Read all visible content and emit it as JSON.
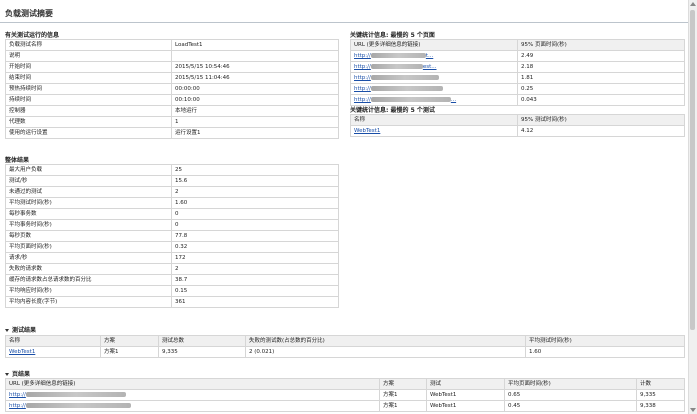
{
  "page_title": "负载测试摘要",
  "run_info": {
    "title": "有关测试运行的信息",
    "rows": [
      {
        "k": "负载测试名称",
        "v": "LoadTest1"
      },
      {
        "k": "说明",
        "v": ""
      },
      {
        "k": "开始时间",
        "v": "2015/5/15 10:54:46"
      },
      {
        "k": "结束时间",
        "v": "2015/5/15 11:04:46"
      },
      {
        "k": "预热持续时间",
        "v": "00:00:00"
      },
      {
        "k": "持续时间",
        "v": "00:10:00"
      },
      {
        "k": "控制器",
        "v": "本地运行"
      },
      {
        "k": "代理数",
        "v": "1"
      },
      {
        "k": "使用的运行设置",
        "v": "运行设置1"
      }
    ]
  },
  "overall": {
    "title": "整体结果",
    "rows": [
      {
        "k": "最大用户负载",
        "v": "25"
      },
      {
        "k": "测试/秒",
        "v": "15.6"
      },
      {
        "k": "未通过的测试",
        "v": "2"
      },
      {
        "k": "平均测试时间(秒)",
        "v": "1.60"
      },
      {
        "k": "每秒事务数",
        "v": "0"
      },
      {
        "k": "平均事务时间(秒)",
        "v": "0"
      },
      {
        "k": "每秒页数",
        "v": "77.8"
      },
      {
        "k": "平均页面时间(秒)",
        "v": "0.32"
      },
      {
        "k": "请求/秒",
        "v": "172"
      },
      {
        "k": "失败的请求数",
        "v": "2"
      },
      {
        "k": "缓存的请求数占总请求数的百分比",
        "v": "38.7"
      },
      {
        "k": "平均响应时间(秒)",
        "v": "0.15"
      },
      {
        "k": "平均内容长度(字节)",
        "v": "361"
      }
    ]
  },
  "slow_pages": {
    "title": "关键统计信息: 最慢的 5 个页面",
    "headers": [
      "URL (更多详细信息的链接)",
      "95% 页面时间(秒)"
    ],
    "rows": [
      {
        "url_a": "http://",
        "url_b": "t...",
        "v": "2.49"
      },
      {
        "url_a": "http://",
        "url_b": "est...",
        "v": "2.18"
      },
      {
        "url_a": "http://",
        "url_b": "",
        "v": "1.81"
      },
      {
        "url_a": "http://",
        "url_b": "",
        "v": "0.25"
      },
      {
        "url_a": "http://",
        "url_b": "...",
        "v": "0.043"
      }
    ]
  },
  "slow_tests": {
    "title": "关键统计信息: 最慢的 5 个测试",
    "headers": [
      "名称",
      "95% 测试时间(秒)"
    ],
    "rows": [
      {
        "name": "WebTest1",
        "v": "4.12"
      }
    ]
  },
  "test_results": {
    "title": "测试结果",
    "headers": [
      "名称",
      "方案",
      "测试总数",
      "失败的测试数(占总数的百分比)",
      "平均测试时间(秒)"
    ],
    "rows": [
      {
        "name": "WebTest1",
        "scenario": "方案1",
        "total": "9,335",
        "failed": "2 (0.021)",
        "avg": "1.60"
      }
    ]
  },
  "page_results": {
    "title": "页结果",
    "headers": [
      "URL (更多详细信息的链接)",
      "方案",
      "测试",
      "平均页面时间(秒)",
      "计数"
    ],
    "rows": [
      {
        "url": "http://",
        "scenario": "方案1",
        "test": "WebTest1",
        "avg": "0.65",
        "count": "9,335"
      },
      {
        "url": "http://",
        "scenario": "方案1",
        "test": "WebTest1",
        "avg": "0.45",
        "count": "9,338"
      }
    ]
  }
}
